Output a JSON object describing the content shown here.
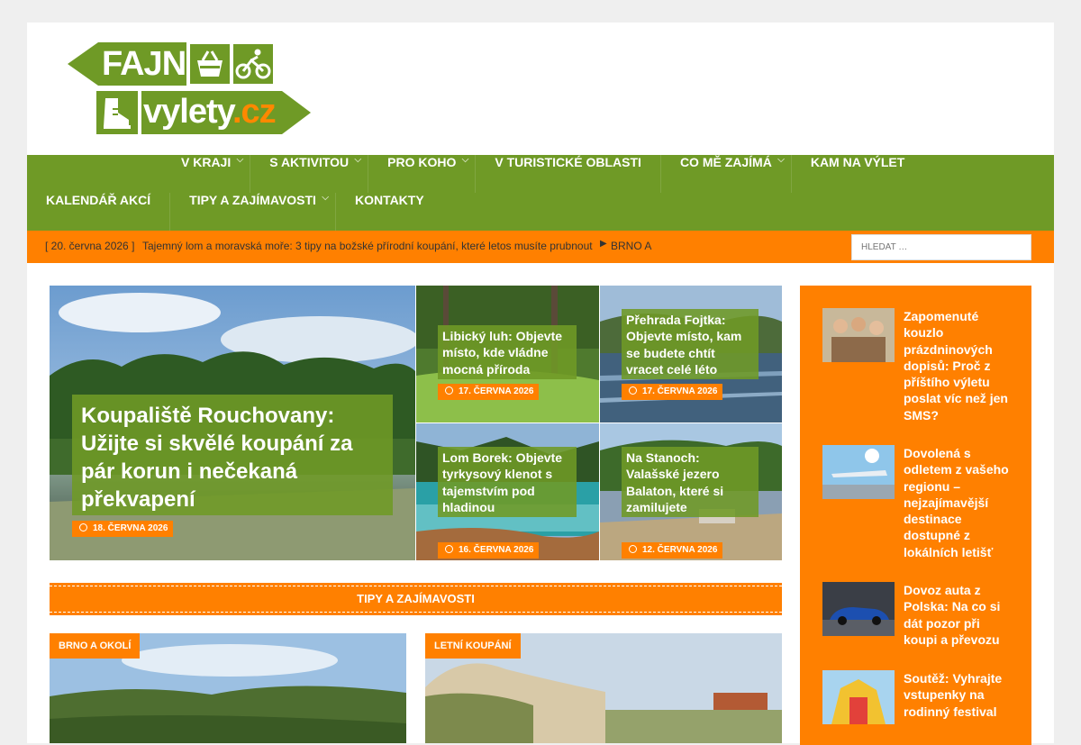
{
  "logo": {
    "line1": "FAJN",
    "line2_main": "vylety",
    "line2_tld": ".cz"
  },
  "nav": {
    "row1": [
      {
        "label": "V KRAJI",
        "dropdown": true
      },
      {
        "label": "S AKTIVITOU",
        "dropdown": true
      },
      {
        "label": "PRO KOHO",
        "dropdown": true
      },
      {
        "label": "V TURISTICKÉ OBLASTI",
        "dropdown": false
      },
      {
        "label": "CO MĚ ZAJÍMÁ",
        "dropdown": true
      },
      {
        "label": "KAM NA VÝLET",
        "dropdown": false
      }
    ],
    "row2": [
      {
        "label": "KALENDÁŘ AKCÍ",
        "dropdown": false
      },
      {
        "label": "TIPY A ZAJÍMAVOSTI",
        "dropdown": true
      },
      {
        "label": "KONTAKTY",
        "dropdown": false
      }
    ]
  },
  "ticker": {
    "date": "[ 20. června 2026 ]",
    "headline": "Tajemný lom a moravská moře: 3 tipy na božské přírodní koupání, které letos musíte prubnout",
    "next": "BRNO A"
  },
  "search": {
    "placeholder": "HLEDAT …"
  },
  "featured": {
    "main": {
      "title": "Koupaliště Rouchovany: Užijte si skvělé koupání za pár korun i nečekaná překvapení",
      "date": "18. ČERVNA 2026"
    },
    "tiles": [
      {
        "title": "Libický luh: Objevte místo, kde vládne mocná příroda",
        "date": "17. ČERVNA 2026"
      },
      {
        "title": "Přehrada Fojtka: Objevte místo, kam se budete chtít vracet celé léto",
        "date": "17. ČERVNA 2026"
      },
      {
        "title": "Lom Borek: Objevte tyrkysový klenot s tajemstvím pod hladinou",
        "date": "16. ČERVNA 2026"
      },
      {
        "title": "Na Stanoch: Valašské jezero Balaton, které si zamilujete",
        "date": "12. ČERVNA 2026"
      }
    ]
  },
  "section": {
    "title": "TIPY A ZAJÍMAVOSTI"
  },
  "cards": [
    {
      "category": "BRNO A OKOLÍ"
    },
    {
      "category": "LETNÍ KOUPÁNÍ"
    }
  ],
  "sidebar": [
    {
      "title": "Zapomenuté kouzlo prázdninových dopisů: Proč z příštího výletu poslat víc než jen SMS?"
    },
    {
      "title": "Dovolená s odletem z vašeho regionu – nejzajímavější destinace dostupné z lokálních letišť"
    },
    {
      "title": "Dovoz auta z Polska: Na co si dát pozor při koupi a převozu"
    },
    {
      "title": "Soutěž: Vyhrajte vstupenky na rodinný festival"
    }
  ],
  "colors": {
    "green": "#6f9a26",
    "orange": "#ff8000",
    "background": "#efefef"
  }
}
